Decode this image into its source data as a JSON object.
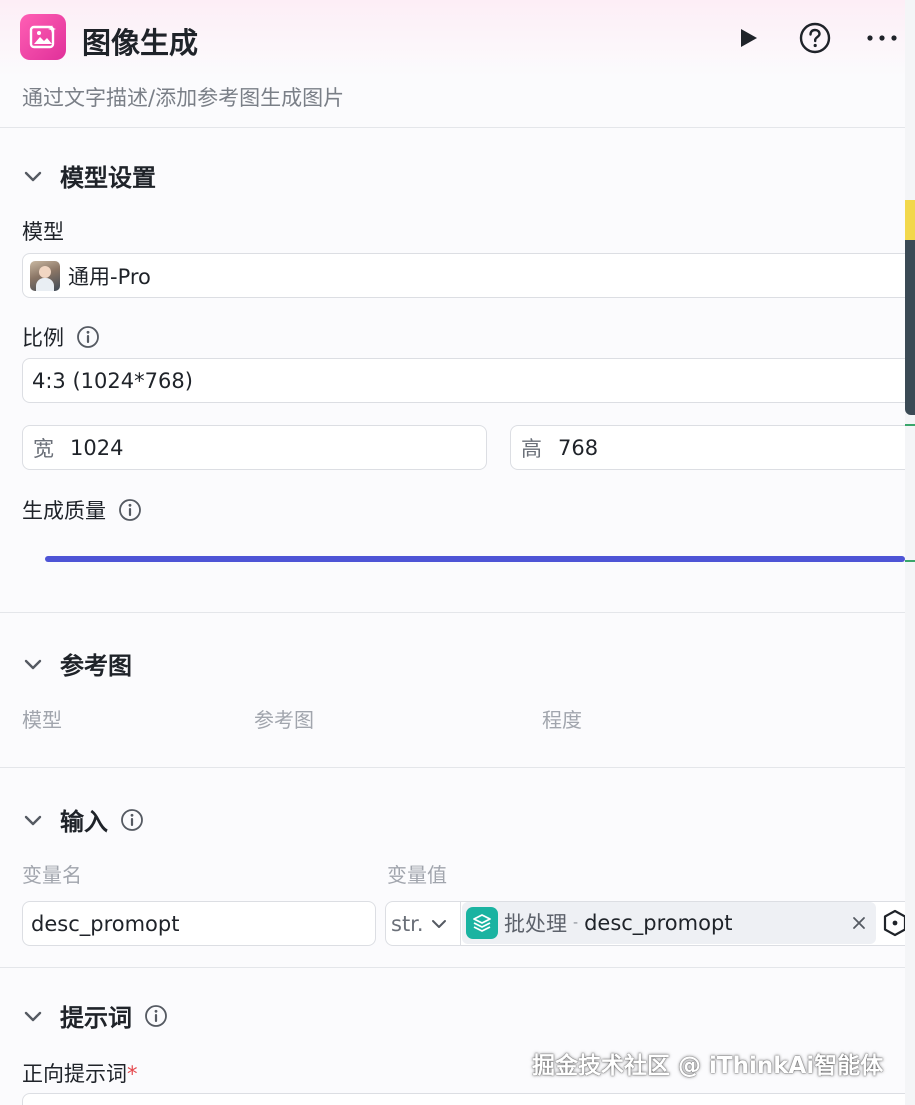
{
  "header": {
    "title": "图像生成",
    "description": "通过文字描述/添加参考图生成图片",
    "run_icon": "play-icon",
    "help_icon": "help-circle-icon",
    "more_icon": "more-horizontal-icon"
  },
  "model_settings": {
    "section_title": "模型设置",
    "model_label": "模型",
    "model_value": "通用-Pro",
    "ratio_label": "比例",
    "ratio_value": "4:3 (1024*768)",
    "width_prefix": "宽",
    "width_value": "1024",
    "height_prefix": "高",
    "height_value": "768",
    "quality_label": "生成质量",
    "quality_level": 1.0
  },
  "reference": {
    "section_title": "参考图",
    "col_model": "模型",
    "col_image": "参考图",
    "col_degree": "程度"
  },
  "input": {
    "section_title": "输入",
    "col_name": "变量名",
    "col_value": "变量值",
    "var_name": "desc_promopt",
    "type_value": "str.",
    "ref_source": "批处理",
    "ref_sep": "-",
    "ref_var": "desc_promopt"
  },
  "prompt": {
    "section_title": "提示词",
    "positive_label": "正向提示词",
    "required_mark": "*"
  },
  "watermark": "掘金技术社区 @ iThinkAi智能体",
  "colors": {
    "accent": "#4e54d6",
    "app_icon": "#e0309a",
    "chip_icon": "#1ab3a1",
    "required": "#e5484d"
  }
}
